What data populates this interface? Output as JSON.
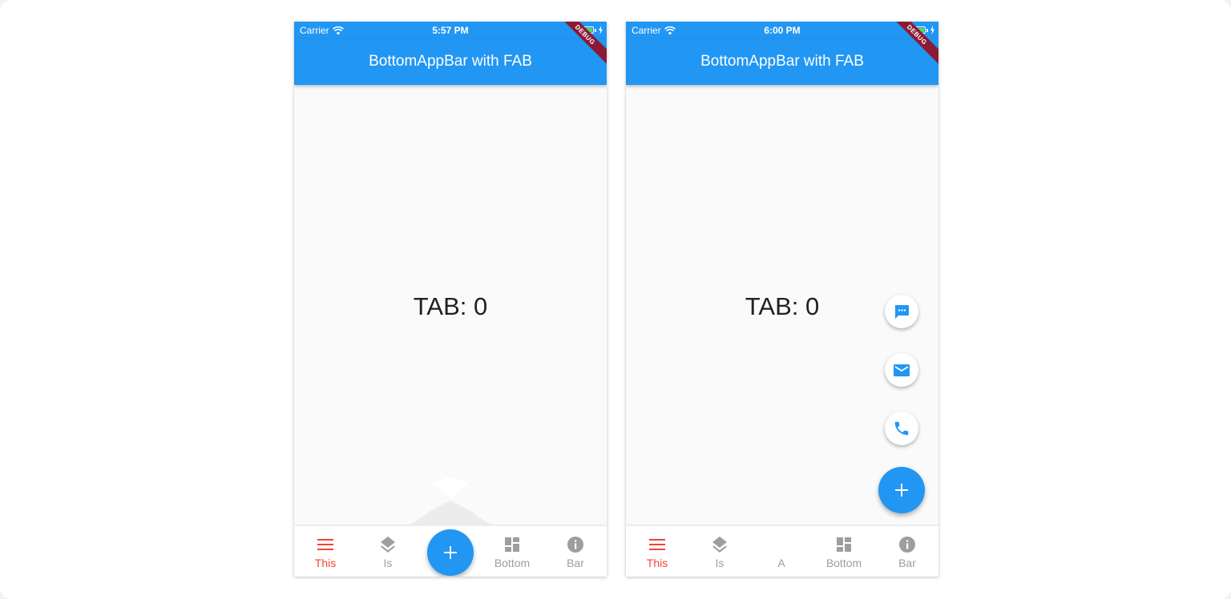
{
  "screens": [
    {
      "status": {
        "carrier": "Carrier",
        "time": "5:57 PM"
      },
      "debug_label": "DEBUG",
      "app_bar_title": "BottomAppBar with FAB",
      "body_text": "TAB: 0",
      "fab_icon": "plus-icon",
      "nav_items": [
        {
          "label": "This",
          "icon": "menu-icon",
          "active": true
        },
        {
          "label": "Is",
          "icon": "layers-icon",
          "active": false
        },
        {
          "label": "Bottom",
          "icon": "dashboard-icon",
          "active": false
        },
        {
          "label": "Bar",
          "icon": "info-icon",
          "active": false
        }
      ]
    },
    {
      "status": {
        "carrier": "Carrier",
        "time": "6:00 PM"
      },
      "debug_label": "DEBUG",
      "app_bar_title": "BottomAppBar with FAB",
      "body_text": "TAB: 0",
      "fab_icon": "plus-icon",
      "mini_fabs": [
        "chat-icon",
        "mail-icon",
        "phone-icon"
      ],
      "nav_items": [
        {
          "label": "This",
          "icon": "menu-icon",
          "active": true
        },
        {
          "label": "Is",
          "icon": "layers-icon",
          "active": false
        },
        {
          "label": "A",
          "icon": "",
          "active": false
        },
        {
          "label": "Bottom",
          "icon": "dashboard-icon",
          "active": false
        },
        {
          "label": "Bar",
          "icon": "info-icon",
          "active": false
        }
      ]
    }
  ],
  "colors": {
    "primary": "#2196f3",
    "active_tab": "#f44336",
    "inactive_tab": "#9e9e9e",
    "debug_banner": "#8b1a36",
    "battery": "#4cd964"
  }
}
